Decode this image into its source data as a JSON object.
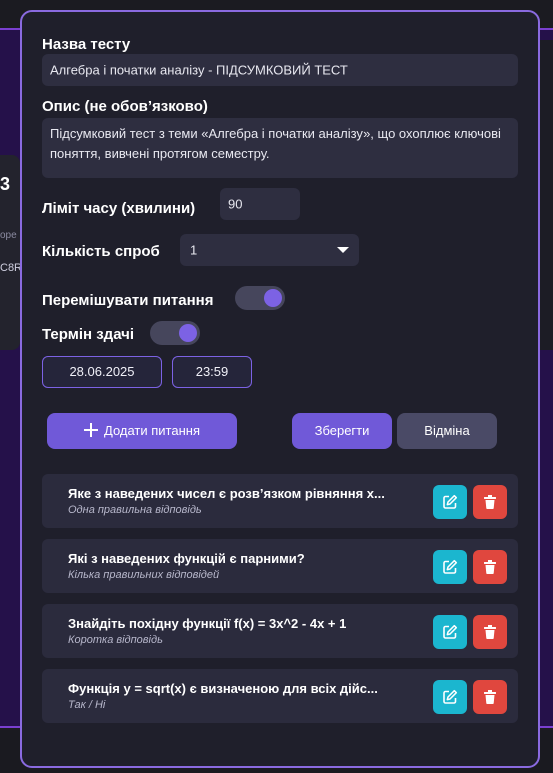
{
  "background": {
    "peek_number": "3",
    "peek_text_1": "оре",
    "peek_text_2": "C8R"
  },
  "form": {
    "title_label": "Назва тесту",
    "title_value": "Алгебра і початки аналізу - ПІДСУМКОВИЙ ТЕСТ",
    "description_label": "Опис (не обов’язково)",
    "description_value": "Підсумковий тест з теми «Алгебра і початки аналізу», що охоплює ключові поняття, вивчені протягом семестру.",
    "time_limit_label": "Ліміт часу (хвилини)",
    "time_limit_value": "90",
    "attempts_label": "Кількість спроб",
    "attempts_value": "1",
    "shuffle_label": "Перемішувати питання",
    "shuffle_on": true,
    "deadline_label": "Термін здачі",
    "deadline_on": true,
    "deadline_date": "28.06.2025",
    "deadline_time": "23:59"
  },
  "buttons": {
    "add_question": "Додати питання",
    "save": "Зберегти",
    "cancel": "Відміна"
  },
  "questions": [
    {
      "title": "Яке з наведених чисел є розв’язком рівняння х...",
      "type": "Одна правильна відповідь"
    },
    {
      "title": "Які з наведених функцій є парними?",
      "type": "Кілька правильних відповідей"
    },
    {
      "title": "Знайдіть похідну функції f(x) = 3x^2 - 4x + 1",
      "type": "Коротка відповідь"
    },
    {
      "title": "Функція y = sqrt(x) є визначеною для всіх дійс...",
      "type": "Так / Ні"
    }
  ],
  "colors": {
    "accent": "#7059d8",
    "edit": "#1bb6cf",
    "delete": "#e0473e",
    "modal_border": "#8a6ae0"
  }
}
